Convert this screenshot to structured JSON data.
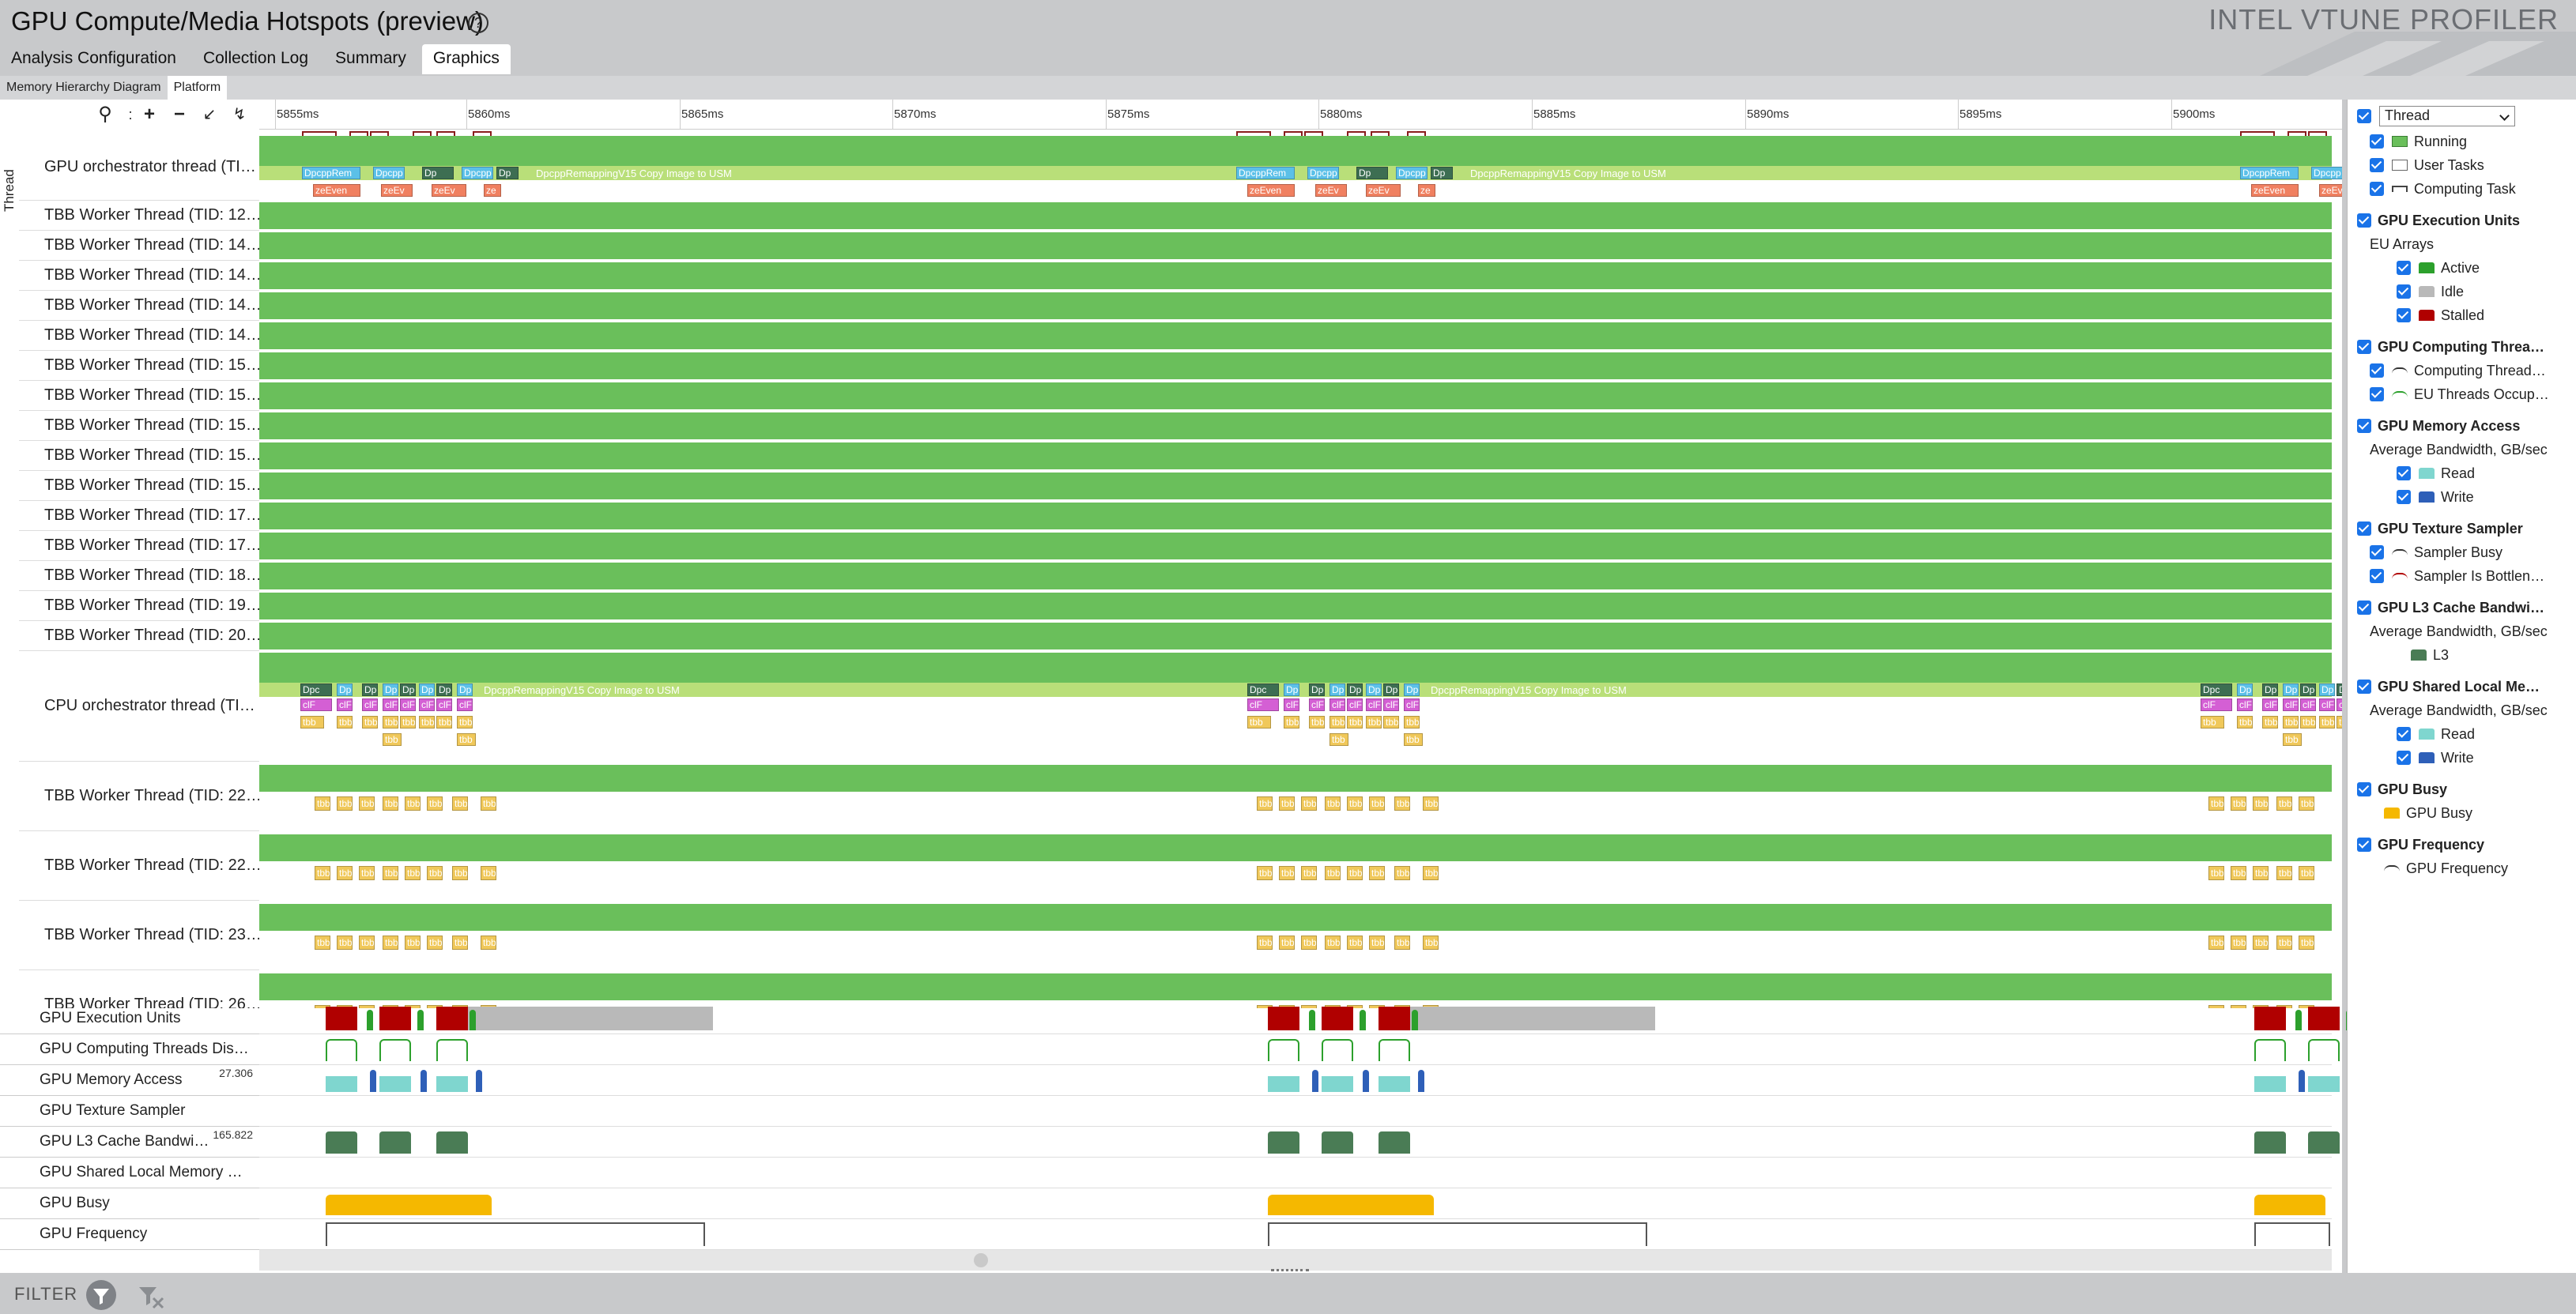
{
  "app": {
    "title": "GPU Compute/Media Hotspots (preview)",
    "brand": "INTEL VTUNE PROFILER",
    "help_icon": "help-circle-icon"
  },
  "tabs": [
    {
      "label": "Analysis Configuration",
      "active": false
    },
    {
      "label": "Collection Log",
      "active": false
    },
    {
      "label": "Summary",
      "active": false
    },
    {
      "label": "Graphics",
      "active": true
    }
  ],
  "subtabs": [
    {
      "label": "Memory Hierarchy Diagram",
      "active": false
    },
    {
      "label": "Platform",
      "active": true
    }
  ],
  "toolbar": {
    "search_icon": "search-icon",
    "zoom_in_icon": "plus-icon",
    "zoom_out_icon": "minus-icon",
    "zoom_fit_icon": "zoom-fit-icon",
    "reset_icon": "reset-zoom-icon"
  },
  "timeline": {
    "axis_label": "Thread",
    "ticks": [
      "5855ms",
      "5860ms",
      "5865ms",
      "5870ms",
      "5875ms",
      "5880ms",
      "5885ms",
      "5890ms",
      "5895ms",
      "5900ms"
    ],
    "rows": [
      {
        "label": "GPU orchestrator thread (TI…",
        "kind": "orchestrator-gpu"
      },
      {
        "label": "TBB Worker Thread (TID: 12…",
        "kind": "simple"
      },
      {
        "label": "TBB Worker Thread (TID: 14…",
        "kind": "simple"
      },
      {
        "label": "TBB Worker Thread (TID: 14…",
        "kind": "simple"
      },
      {
        "label": "TBB Worker Thread (TID: 14…",
        "kind": "simple"
      },
      {
        "label": "TBB Worker Thread (TID: 14…",
        "kind": "simple"
      },
      {
        "label": "TBB Worker Thread (TID: 15…",
        "kind": "simple"
      },
      {
        "label": "TBB Worker Thread (TID: 15…",
        "kind": "simple"
      },
      {
        "label": "TBB Worker Thread (TID: 15…",
        "kind": "simple"
      },
      {
        "label": "TBB Worker Thread (TID: 15…",
        "kind": "simple"
      },
      {
        "label": "TBB Worker Thread (TID: 15…",
        "kind": "simple"
      },
      {
        "label": "TBB Worker Thread (TID: 17…",
        "kind": "simple"
      },
      {
        "label": "TBB Worker Thread (TID: 17…",
        "kind": "simple"
      },
      {
        "label": "TBB Worker Thread (TID: 18…",
        "kind": "simple"
      },
      {
        "label": "TBB Worker Thread (TID: 19…",
        "kind": "simple"
      },
      {
        "label": "TBB Worker Thread (TID: 20…",
        "kind": "simple"
      },
      {
        "label": "CPU orchestrator thread (TI…",
        "kind": "orchestrator-cpu"
      },
      {
        "label": "TBB Worker Thread (TID: 22…",
        "kind": "tasks"
      },
      {
        "label": "TBB Worker Thread (TID: 22…",
        "kind": "tasks"
      },
      {
        "label": "TBB Worker Thread (TID: 23…",
        "kind": "tasks"
      },
      {
        "label": "TBB Worker Thread (TID: 26…",
        "kind": "tasks"
      }
    ],
    "task_text": {
      "remap": "DpcppRemappingV15 Copy Image to USM",
      "dpc_short": "Dpc",
      "dpcpp": "Dpcpp",
      "dpcpprem": "DpcppRem",
      "zeevent": "zeEven",
      "zeevent_short": "zeEv",
      "ze": "ze",
      "tbb": "tbb",
      "tbb_pa": "tbb_pa",
      "clf": "clF",
      "dp": "Dp",
      "d": "D"
    }
  },
  "gpu_metrics": [
    {
      "label": "GPU Execution Units",
      "max": ""
    },
    {
      "label": "GPU Computing Threads Dis…",
      "max": ""
    },
    {
      "label": "GPU Memory Access",
      "max": "27.306"
    },
    {
      "label": "GPU Texture Sampler",
      "max": ""
    },
    {
      "label": "GPU L3 Cache Bandwi…",
      "max": "165.822"
    },
    {
      "label": "GPU Shared Local Memory …",
      "max": ""
    },
    {
      "label": "GPU Busy",
      "max": ""
    },
    {
      "label": "GPU Frequency",
      "max": ""
    }
  ],
  "footer": {
    "filter_label": "FILTER",
    "filter_icon": "filter-icon",
    "clear_filter_icon": "clear-filter-icon"
  },
  "legend": {
    "selector": "Thread",
    "groups": [
      {
        "title": "",
        "items": [
          {
            "label": "Running",
            "swatch": "running",
            "color": "#6abf5b",
            "checked": true
          },
          {
            "label": "User Tasks",
            "swatch": "box",
            "color": "#ffffff",
            "checked": true
          },
          {
            "label": "Computing Task",
            "swatch": "bracket",
            "color": "#444444",
            "checked": true
          }
        ]
      },
      {
        "title": "GPU Execution Units",
        "subtitle": "EU Arrays",
        "items": [
          {
            "label": "Active",
            "swatch": "area",
            "color": "#2ca02c",
            "checked": true
          },
          {
            "label": "Idle",
            "swatch": "area",
            "color": "#b9b9b9",
            "checked": true
          },
          {
            "label": "Stalled",
            "swatch": "area",
            "color": "#b00000",
            "checked": true
          }
        ]
      },
      {
        "title": "GPU Computing Threa…",
        "items": [
          {
            "label": "Computing Thread…",
            "swatch": "line",
            "color": "#333333",
            "checked": true
          },
          {
            "label": "EU Threads Occup…",
            "swatch": "line",
            "color": "#2ca02c",
            "checked": true
          }
        ]
      },
      {
        "title": "GPU Memory Access",
        "subtitle": "Average Bandwidth, GB/sec",
        "items": [
          {
            "label": "Read",
            "swatch": "area",
            "color": "#7fd6cf",
            "checked": true
          },
          {
            "label": "Write",
            "swatch": "area",
            "color": "#2e5fb8",
            "checked": true
          }
        ]
      },
      {
        "title": "GPU Texture Sampler",
        "items": [
          {
            "label": "Sampler Busy",
            "swatch": "line",
            "color": "#333333",
            "checked": true
          },
          {
            "label": "Sampler Is Bottlen…",
            "swatch": "line",
            "color": "#b00000",
            "checked": true
          }
        ]
      },
      {
        "title": "GPU L3 Cache Bandwi…",
        "subtitle": "Average Bandwidth, GB/sec",
        "items": [
          {
            "label": "L3",
            "swatch": "area",
            "color": "#4a7c55",
            "checked": null
          }
        ]
      },
      {
        "title": "GPU Shared Local Me…",
        "subtitle": "Average Bandwidth, GB/sec",
        "items": [
          {
            "label": "Read",
            "swatch": "area",
            "color": "#7fd6cf",
            "checked": true
          },
          {
            "label": "Write",
            "swatch": "area",
            "color": "#2e5fb8",
            "checked": true
          }
        ]
      },
      {
        "title": "GPU Busy",
        "items": [
          {
            "label": "GPU Busy",
            "swatch": "area",
            "color": "#f5b800",
            "checked": null
          }
        ]
      },
      {
        "title": "GPU Frequency",
        "items": [
          {
            "label": "GPU Frequency",
            "swatch": "line",
            "color": "#333333",
            "checked": null
          }
        ]
      }
    ]
  },
  "colors": {
    "running": "#6abf5b",
    "gpu_task_band": "#b9df79",
    "task_blue": "#5bc0e8",
    "task_salmon": "#f08060",
    "task_yellow": "#f0c85a",
    "task_magenta": "#d45fd4",
    "eu_stalled": "#b00000",
    "eu_idle": "#b9b9b9",
    "eu_active": "#2ca02c",
    "mem_read": "#7fd6cf",
    "mem_write": "#2e5fb8",
    "l3": "#4a7c55",
    "busy": "#f5b800"
  }
}
